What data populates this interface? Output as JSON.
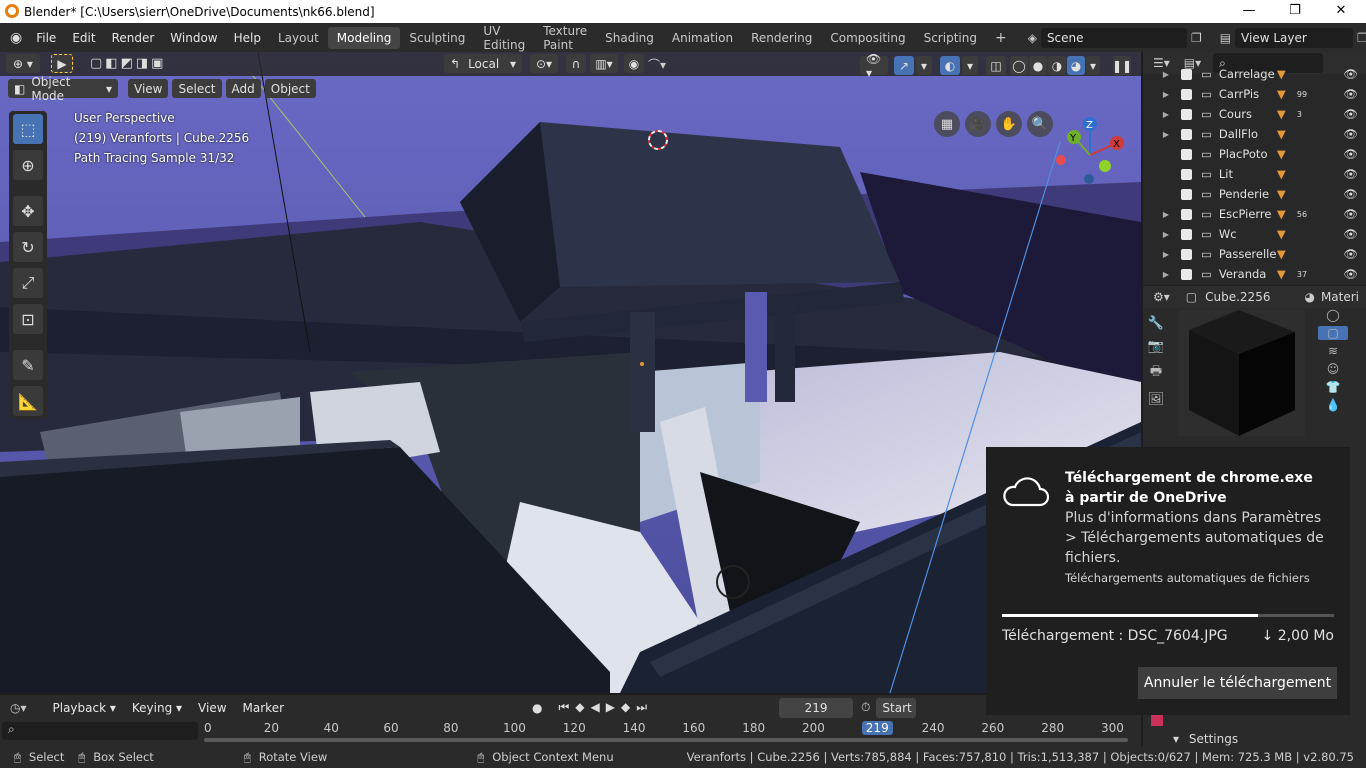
{
  "window": {
    "title": "Blender* [C:\\Users\\sierr\\OneDrive\\Documents\\nk66.blend]",
    "minimize": "—",
    "restore": "❐",
    "close": "✕"
  },
  "menu": [
    "File",
    "Edit",
    "Render",
    "Window",
    "Help"
  ],
  "workspaces": [
    "Layout",
    "Modeling",
    "Sculpting",
    "UV Editing",
    "Texture Paint",
    "Shading",
    "Animation",
    "Rendering",
    "Compositing",
    "Scripting"
  ],
  "active_workspace": "Modeling",
  "scene": {
    "name": "Scene",
    "view_layer": "View Layer"
  },
  "viewport": {
    "orientation": "Local",
    "mode": "Object Mode",
    "header_menus": [
      "View",
      "Select",
      "Add",
      "Object"
    ],
    "overlay_lines": [
      "User Perspective",
      "(219) Veranforts | Cube.2256",
      "Path Tracing Sample 31/32"
    ]
  },
  "outliner": {
    "rows": [
      {
        "name": "Carrelage",
        "expand": true
      },
      {
        "name": "CarrPis",
        "expand": true,
        "badge": "99"
      },
      {
        "name": "Cours",
        "expand": true,
        "badge": "3"
      },
      {
        "name": "DallFlo",
        "expand": true,
        "badge": ""
      },
      {
        "name": "PlacPoto",
        "expand": false,
        "badge": ""
      },
      {
        "name": "Lit",
        "expand": false,
        "badge": ""
      },
      {
        "name": "Penderie",
        "expand": false,
        "badge": ""
      },
      {
        "name": "EscPierre",
        "expand": true,
        "badge": "56"
      },
      {
        "name": "Wc",
        "expand": true,
        "badge": ""
      },
      {
        "name": "Passerelle",
        "expand": true,
        "badge": ""
      },
      {
        "name": "Veranda",
        "expand": true,
        "badge": "37"
      }
    ]
  },
  "properties": {
    "object_name": "Cube.2256",
    "tab_label": "Materi",
    "settings_label": "Settings"
  },
  "timeline": {
    "menus": [
      "Playback",
      "Keying",
      "View",
      "Marker"
    ],
    "current_frame": "219",
    "start_label": "Start",
    "ticks": [
      "0",
      "20",
      "40",
      "60",
      "80",
      "100",
      "120",
      "140",
      "160",
      "180",
      "200",
      "219",
      "240",
      "260",
      "280",
      "300"
    ]
  },
  "statusbar": {
    "select": "Select",
    "box_select": "Box Select",
    "rotate_view": "Rotate View",
    "context_menu": "Object Context Menu",
    "stats": "Veranforts | Cube.2256 | Verts:785,884 | Faces:757,810 | Tris:1,513,387 | Objects:0/627 | Mem: 725.3 MB | v2.80.75"
  },
  "toast": {
    "title": "Téléchargement de chrome.exe à partir de OneDrive",
    "body": "Plus d'informations dans Paramètres > Téléchargements automatiques de fichiers.",
    "source": "Téléchargements automatiques de fichiers",
    "progress": 0.77,
    "file_label": "Téléchargement : DSC_7604.JPG",
    "size_label": "↓ 2,00 Mo",
    "cancel_label": "Annuler le téléchargement"
  },
  "colors": {
    "accent": "#4772b3",
    "wire_orange": "#e8963a",
    "sky": "#5c5cb4"
  }
}
